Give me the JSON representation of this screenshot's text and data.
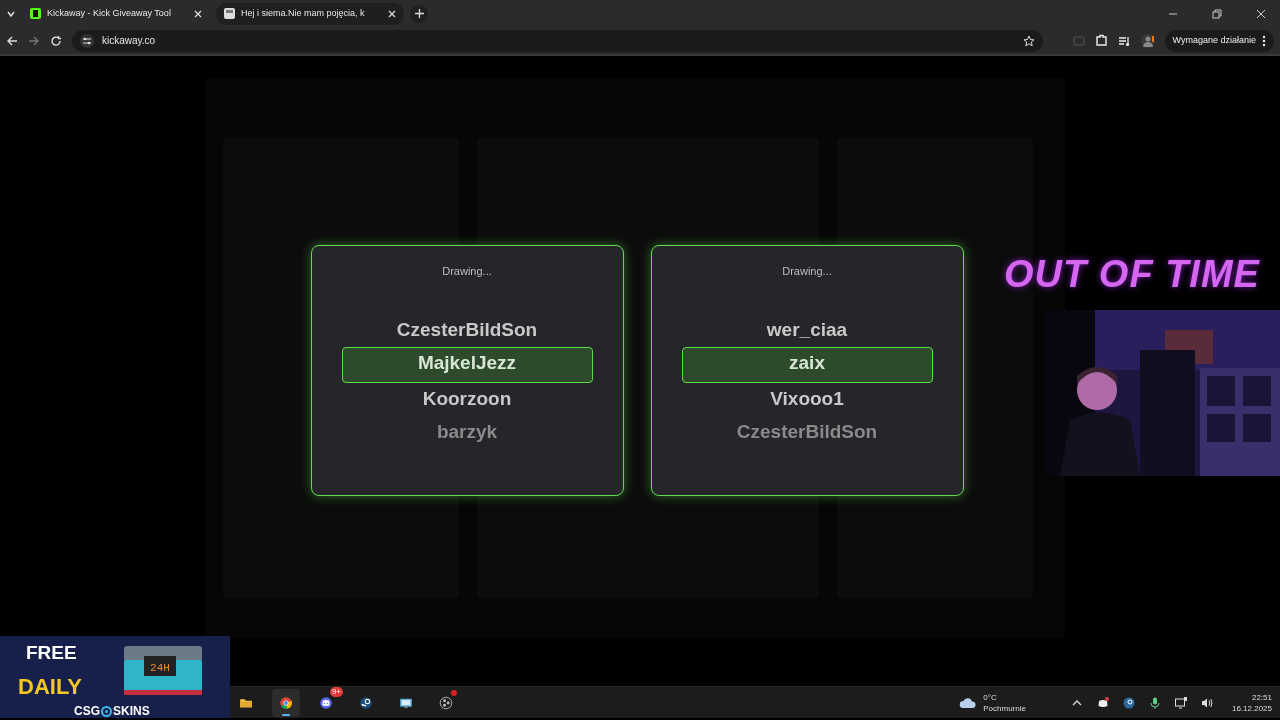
{
  "browser": {
    "tabs": [
      {
        "title": "Kickaway - Kick Giveaway Tool",
        "selected": true
      },
      {
        "title": "Hej i siema.Nie mam pojęcia, k",
        "selected": false
      }
    ],
    "address": "kickaway.co",
    "profile_action": "Wymagane działanie"
  },
  "draw_panels": [
    {
      "status": "Drawing...",
      "names": [
        {
          "name": "CzesterBildSon",
          "selected": false
        },
        {
          "name": "MajkelJezz",
          "selected": true
        },
        {
          "name": "Koorzoon",
          "selected": false
        },
        {
          "name": "barzyk",
          "selected": false
        }
      ]
    },
    {
      "status": "Drawing...",
      "names": [
        {
          "name": "wer_ciaa",
          "selected": false
        },
        {
          "name": "zaix",
          "selected": true
        },
        {
          "name": "Vixooo1",
          "selected": false
        },
        {
          "name": "CzesterBildSon",
          "selected": false
        }
      ]
    }
  ],
  "stream_overlay": {
    "logo": "OUT OF TIME",
    "sponsor": {
      "lines": [
        "FREE",
        "DAILY"
      ],
      "chest_label": "24H",
      "brand_left": "CSG",
      "brand_right": "SKINS"
    }
  },
  "taskbar": {
    "apps": [
      {
        "kind": "files",
        "selected": false,
        "alert": false
      },
      {
        "kind": "chrome",
        "selected": true,
        "alert": false
      },
      {
        "kind": "discord",
        "selected": false,
        "alert": false,
        "badge": "9+"
      },
      {
        "kind": "steam",
        "selected": false,
        "alert": false
      },
      {
        "kind": "monitor",
        "selected": false,
        "alert": false
      },
      {
        "kind": "obs",
        "selected": false,
        "alert": true
      }
    ],
    "weather": {
      "temp": "0°C",
      "condition": "Pochmurnie"
    },
    "time": "22:51",
    "date": "16.12.2025"
  }
}
